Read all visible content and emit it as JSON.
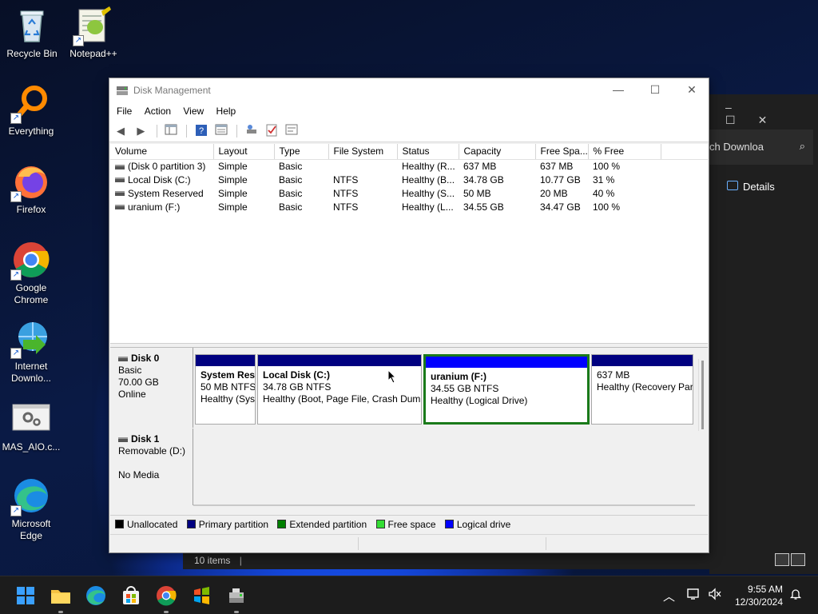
{
  "desktop": {
    "icons": [
      {
        "label": "Recycle Bin"
      },
      {
        "label": "Notepad++"
      },
      {
        "label": "Everything"
      },
      {
        "label": "Firefox"
      },
      {
        "label": "Google Chrome"
      },
      {
        "label": "Internet Downlo..."
      },
      {
        "label": "MAS_AIO.c..."
      },
      {
        "label": "Microsoft Edge"
      }
    ]
  },
  "explorer_bg": {
    "search_text": "ch Downloa",
    "details_label": "Details",
    "status_items": "10 items"
  },
  "window": {
    "title": "Disk Management",
    "menu": [
      "File",
      "Action",
      "View",
      "Help"
    ],
    "columns": [
      "Volume",
      "Layout",
      "Type",
      "File System",
      "Status",
      "Capacity",
      "Free Spa...",
      "% Free"
    ],
    "volumes": [
      {
        "volume": "(Disk 0 partition 3)",
        "layout": "Simple",
        "type": "Basic",
        "fs": "",
        "status": "Healthy (R...",
        "capacity": "637 MB",
        "free": "637 MB",
        "pct": "100 %"
      },
      {
        "volume": "Local Disk (C:)",
        "layout": "Simple",
        "type": "Basic",
        "fs": "NTFS",
        "status": "Healthy (B...",
        "capacity": "34.78 GB",
        "free": "10.77 GB",
        "pct": "31 %"
      },
      {
        "volume": "System Reserved",
        "layout": "Simple",
        "type": "Basic",
        "fs": "NTFS",
        "status": "Healthy (S...",
        "capacity": "50 MB",
        "free": "20 MB",
        "pct": "40 %"
      },
      {
        "volume": "uranium (F:)",
        "layout": "Simple",
        "type": "Basic",
        "fs": "NTFS",
        "status": "Healthy (L...",
        "capacity": "34.55 GB",
        "free": "34.47 GB",
        "pct": "100 %"
      }
    ],
    "disk0": {
      "name": "Disk 0",
      "type": "Basic",
      "size": "70.00 GB",
      "state": "Online",
      "partitions": [
        {
          "name": "System Res",
          "size": "50 MB NTFS",
          "status": "Healthy (Sys"
        },
        {
          "name": "Local Disk  (C:)",
          "size": "34.78 GB NTFS",
          "status": "Healthy (Boot, Page File, Crash Dum"
        },
        {
          "name": "uranium  (F:)",
          "size": "34.55 GB NTFS",
          "status": "Healthy (Logical Drive)"
        },
        {
          "name": "",
          "size": "637 MB",
          "status": "Healthy (Recovery Par"
        }
      ]
    },
    "disk1": {
      "name": "Disk 1",
      "type": "Removable (D:)",
      "state": "No Media"
    },
    "legend": [
      {
        "label": "Unallocated",
        "color": "#000000"
      },
      {
        "label": "Primary partition",
        "color": "#000080"
      },
      {
        "label": "Extended partition",
        "color": "#008000"
      },
      {
        "label": "Free space",
        "color": "#33dd33"
      },
      {
        "label": "Logical drive",
        "color": "#0000ff"
      }
    ]
  },
  "taskbar": {
    "time": "9:55 AM",
    "date": "12/30/2024"
  }
}
